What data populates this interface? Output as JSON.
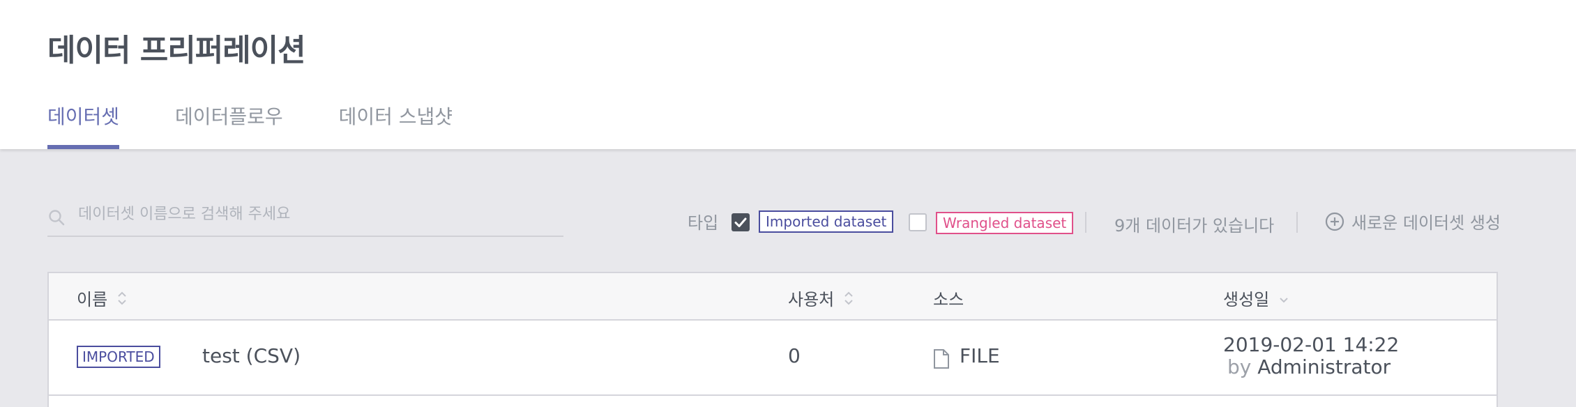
{
  "header": {
    "title": "데이터 프리퍼레이션",
    "tabs": [
      {
        "label": "데이터셋",
        "active": true
      },
      {
        "label": "데이터플로우",
        "active": false
      },
      {
        "label": "데이터 스냅샷",
        "active": false
      }
    ]
  },
  "toolbar": {
    "search": {
      "placeholder": "데이터셋 이름으로 검색해 주세요",
      "value": ""
    },
    "type_label": "타입",
    "filters": [
      {
        "label": "Imported dataset",
        "checked": true,
        "color": "#4a4d9e"
      },
      {
        "label": "Wrangled dataset",
        "checked": false,
        "color": "#e0508a"
      }
    ],
    "count_text": "9개 데이터가 있습니다",
    "create_label": "새로운 데이터셋 생성"
  },
  "table": {
    "columns": [
      {
        "label": "이름",
        "sort_icon": "sort-icon"
      },
      {
        "label": "사용처",
        "sort_icon": "sort-icon"
      },
      {
        "label": "소스"
      },
      {
        "label": "생성일",
        "sort_icon": "sort-desc-icon"
      }
    ],
    "rows": [
      {
        "type_badge": "IMPORTED",
        "name": "test (CSV)",
        "usage": "0",
        "source_icon": "file-icon",
        "source": "FILE",
        "created_date": "2019-02-01 14:22",
        "created_by_prefix": "by",
        "created_by": "Administrator"
      }
    ]
  },
  "colors": {
    "accent": "#666eb2",
    "imported": "#4a4d9e",
    "wrangled": "#e0508a",
    "background": "#e8e8ec"
  }
}
